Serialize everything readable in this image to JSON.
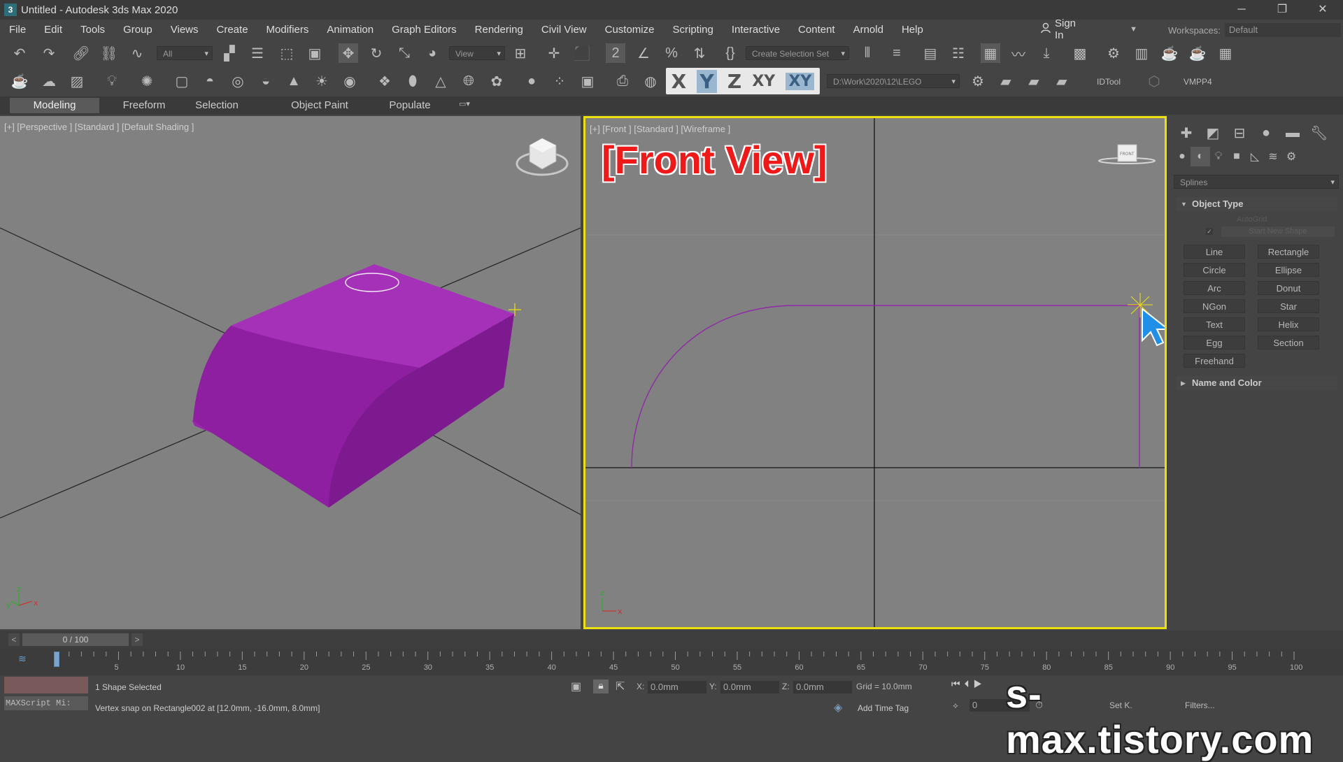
{
  "window": {
    "title": "Untitled - Autodesk 3ds Max 2020",
    "app_icon": "3",
    "min": "─",
    "restore": "❐",
    "close": "✕"
  },
  "menu": [
    "File",
    "Edit",
    "Tools",
    "Group",
    "Views",
    "Create",
    "Modifiers",
    "Animation",
    "Graph Editors",
    "Rendering",
    "Civil View",
    "Customize",
    "Scripting",
    "Interactive",
    "Content",
    "Arnold",
    "Help"
  ],
  "signin": {
    "label": "Sign In"
  },
  "workspaces": {
    "label": "Workspaces:",
    "value": "Default"
  },
  "toolbar": {
    "filter_value": "All",
    "refcoord_value": "View",
    "selection_set_placeholder": "Create Selection Set",
    "path_value": "D:\\Work\\2020\\12\\LEGO",
    "idtool": "IDTool",
    "vmpp": "VMPP4"
  },
  "axis_constraints": {
    "x": "X",
    "y": "Y",
    "z": "Z",
    "xy": "XY",
    "xy2": "XY",
    "active": "Y"
  },
  "ribbon_tabs": [
    "Modeling",
    "Freeform",
    "Selection",
    "Object Paint",
    "Populate"
  ],
  "viewports": {
    "perspective_label": "[+] [Perspective ] [Standard ] [Default Shading ]",
    "front_label": "[+] [Front ] [Standard ] [Wireframe ]",
    "front_annotation": "[Front View]",
    "viewcube_front": "FRONT",
    "shape_color": "#9b27af"
  },
  "command_panel": {
    "category_value": "Splines",
    "object_type_title": "Object Type",
    "autogrid": "AutoGrid",
    "start_new_shape": "Start New Shape",
    "buttons": [
      "Line",
      "Rectangle",
      "Circle",
      "Ellipse",
      "Arc",
      "Donut",
      "NGon",
      "Star",
      "Text",
      "Helix",
      "Egg",
      "Section",
      "Freehand"
    ],
    "name_color_title": "Name and Color"
  },
  "timeslider": {
    "value": "0 / 100",
    "prev": "<",
    "next": ">"
  },
  "track_ticks": [
    "5",
    "10",
    "15",
    "20",
    "25",
    "30",
    "35",
    "40",
    "45",
    "50",
    "55",
    "60",
    "65",
    "70",
    "75",
    "80",
    "85",
    "90",
    "95",
    "100"
  ],
  "status": {
    "selection": "1 Shape Selected",
    "prompt": "Vertex snap on Rectangle002 at [12.0mm, -16.0mm, 8.0mm]",
    "maxscript": "MAXScript Mi:",
    "x_label": "X:",
    "x_value": "0.0mm",
    "y_label": "Y:",
    "y_value": "0.0mm",
    "z_label": "Z:",
    "z_value": "0.0mm",
    "grid": "Grid = 10.0mm",
    "add_time_tag": "Add Time Tag",
    "frame_value": "0",
    "set_k": "Set K.",
    "filters": "Filters..."
  },
  "watermark": "s-max.tistory.com"
}
